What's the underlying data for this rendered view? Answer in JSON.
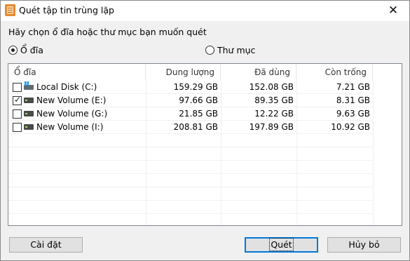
{
  "window": {
    "title": "Quét tập tin trùng lặp",
    "close_glyph": "✕",
    "app_icon": "document-app-icon"
  },
  "prompt": "Hãy chọn ổ đĩa hoặc thư mục bạn muốn quét",
  "scan_mode": {
    "selected": "drive",
    "drive_label": "Ổ đĩa",
    "folder_label": "Thư mục"
  },
  "table": {
    "columns": {
      "name": "Ổ đĩa",
      "size": "Dung lượng",
      "used": "Đã dùng",
      "free": "Còn trống"
    },
    "rows": [
      {
        "name": "Local Disk (C:)",
        "size": "159.29 GB",
        "used": "152.08 GB",
        "free": "7.21 GB",
        "checked": false,
        "icon": "system-drive-icon"
      },
      {
        "name": "New Volume (E:)",
        "size": "97.66 GB",
        "used": "89.35 GB",
        "free": "8.31 GB",
        "checked": true,
        "icon": "hard-drive-icon"
      },
      {
        "name": "New Volume (G:)",
        "size": "21.85 GB",
        "used": "12.22 GB",
        "free": "9.63 GB",
        "checked": false,
        "icon": "hard-drive-icon"
      },
      {
        "name": "New Volume (I:)",
        "size": "208.81 GB",
        "used": "197.89 GB",
        "free": "10.92 GB",
        "checked": false,
        "icon": "hard-drive-icon"
      }
    ]
  },
  "buttons": {
    "settings": "Cài đặt",
    "scan": "Quét",
    "cancel": "Hủy bỏ"
  }
}
